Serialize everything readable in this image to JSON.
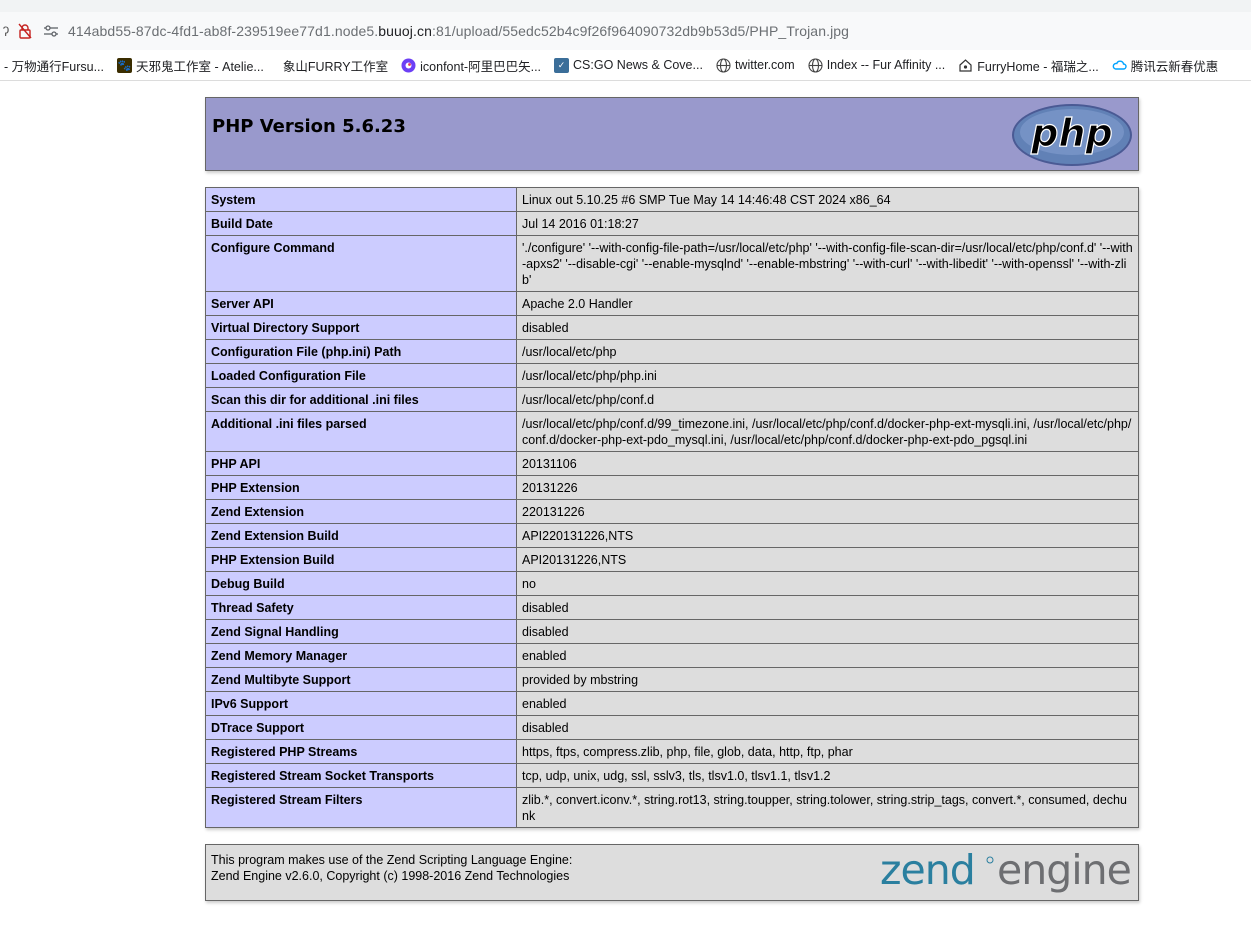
{
  "browser": {
    "url_prefix": "414abd55-87dc-4fd1-ab8f-239519ee77d1.node5.",
    "url_domain": "buuoj.cn",
    "url_suffix": ":81/upload/55edc52b4c9f26f964090732db9b53d5/PHP_Trojan.jpg",
    "left_glyph": "ʔ",
    "bookmarks": [
      {
        "label": "- 万物通行Fursu...",
        "icon": "none"
      },
      {
        "label": "天邪鬼工作室 - Atelie...",
        "icon": "paw-icon"
      },
      {
        "label": "象山FURRY工作室",
        "icon": "none"
      },
      {
        "label": "iconfont-阿里巴巴矢...",
        "icon": "iconfont-icon"
      },
      {
        "label": "CS:GO News & Cove...",
        "icon": "csgo-icon"
      },
      {
        "label": "twitter.com",
        "icon": "globe-icon"
      },
      {
        "label": "Index -- Fur Affinity ...",
        "icon": "globe-icon"
      },
      {
        "label": "FurryHome - 福瑞之...",
        "icon": "house-icon"
      },
      {
        "label": "腾讯云新春优惠",
        "icon": "cloud-icon"
      }
    ]
  },
  "header": {
    "title": "PHP Version 5.6.23",
    "logo_text": "php"
  },
  "rows": [
    {
      "key": "System",
      "value": "Linux out 5.10.25 #6 SMP Tue May 14 14:46:48 CST 2024 x86_64"
    },
    {
      "key": "Build Date",
      "value": "Jul 14 2016 01:18:27"
    },
    {
      "key": "Configure Command",
      "value": "'./configure' '--with-config-file-path=/usr/local/etc/php' '--with-config-file-scan-dir=/usr/local/etc/php/conf.d' '--with-apxs2' '--disable-cgi' '--enable-mysqlnd' '--enable-mbstring' '--with-curl' '--with-libedit' '--with-openssl' '--with-zlib'"
    },
    {
      "key": "Server API",
      "value": "Apache 2.0 Handler"
    },
    {
      "key": "Virtual Directory Support",
      "value": "disabled"
    },
    {
      "key": "Configuration File (php.ini) Path",
      "value": "/usr/local/etc/php"
    },
    {
      "key": "Loaded Configuration File",
      "value": "/usr/local/etc/php/php.ini"
    },
    {
      "key": "Scan this dir for additional .ini files",
      "value": "/usr/local/etc/php/conf.d"
    },
    {
      "key": "Additional .ini files parsed",
      "value": "/usr/local/etc/php/conf.d/99_timezone.ini, /usr/local/etc/php/conf.d/docker-php-ext-mysqli.ini, /usr/local/etc/php/conf.d/docker-php-ext-pdo_mysql.ini, /usr/local/etc/php/conf.d/docker-php-ext-pdo_pgsql.ini"
    },
    {
      "key": "PHP API",
      "value": "20131106"
    },
    {
      "key": "PHP Extension",
      "value": "20131226"
    },
    {
      "key": "Zend Extension",
      "value": "220131226"
    },
    {
      "key": "Zend Extension Build",
      "value": "API220131226,NTS"
    },
    {
      "key": "PHP Extension Build",
      "value": "API20131226,NTS"
    },
    {
      "key": "Debug Build",
      "value": "no"
    },
    {
      "key": "Thread Safety",
      "value": "disabled"
    },
    {
      "key": "Zend Signal Handling",
      "value": "disabled"
    },
    {
      "key": "Zend Memory Manager",
      "value": "enabled"
    },
    {
      "key": "Zend Multibyte Support",
      "value": "provided by mbstring"
    },
    {
      "key": "IPv6 Support",
      "value": "enabled"
    },
    {
      "key": "DTrace Support",
      "value": "disabled"
    },
    {
      "key": "Registered PHP Streams",
      "value": "https, ftps, compress.zlib, php, file, glob, data, http, ftp, phar"
    },
    {
      "key": "Registered Stream Socket Transports",
      "value": "tcp, udp, unix, udg, ssl, sslv3, tls, tlsv1.0, tlsv1.1, tlsv1.2"
    },
    {
      "key": "Registered Stream Filters",
      "value": "zlib.*, convert.iconv.*, string.rot13, string.toupper, string.tolower, string.strip_tags, convert.*, consumed, dechunk"
    }
  ],
  "footer": {
    "line1": "This program makes use of the Zend Scripting Language Engine:",
    "line2": "Zend Engine v2.6.0, Copyright (c) 1998-2016 Zend Technologies",
    "logo_text_a": "zend",
    "logo_text_b": "engine"
  },
  "colors": {
    "header_bg": "#9999cc",
    "key_bg": "#ccccff",
    "value_bg": "#dddddd",
    "php_logo_bg": "#6181b6",
    "zend_teal": "#2a7f9f",
    "zend_gray": "#6d6e71"
  }
}
